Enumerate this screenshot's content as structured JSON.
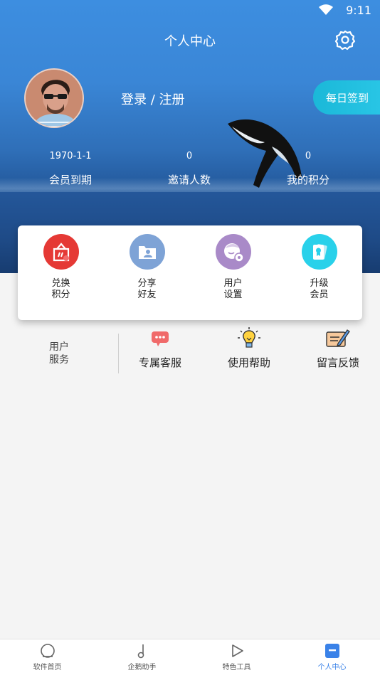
{
  "status_bar": {
    "time": "9:11"
  },
  "header": {
    "title": "个人中心"
  },
  "profile": {
    "login_text": "登录 / 注册",
    "signin_label": "每日签到"
  },
  "stats": [
    {
      "value": "1970-1-1",
      "label": "会员到期"
    },
    {
      "value": "0",
      "label": "邀请人数"
    },
    {
      "value": "0",
      "label": "我的积分"
    }
  ],
  "card_actions": [
    {
      "line1": "兑换",
      "line2": "积分",
      "icon": "gift-icon",
      "color": "#e53935"
    },
    {
      "line1": "分享",
      "line2": "好友",
      "icon": "share-contact-icon",
      "color": "#7ea3d6"
    },
    {
      "line1": "用户",
      "line2": "设置",
      "icon": "user-settings-icon",
      "color": "#a98ac8"
    },
    {
      "line1": "升级",
      "line2": "会员",
      "icon": "vip-card-icon",
      "color": "#29d1ea"
    }
  ],
  "services": {
    "label_line1": "用户",
    "label_line2": "服务",
    "items": [
      {
        "label": "专属客服",
        "icon": "chat-bubble-icon"
      },
      {
        "label": "使用帮助",
        "icon": "lightbulb-icon"
      },
      {
        "label": "留言反馈",
        "icon": "feedback-note-icon"
      }
    ]
  },
  "tabs": [
    {
      "label": "软件首页",
      "icon": "home-circle-icon"
    },
    {
      "label": "企鹅助手",
      "icon": "music-note-icon"
    },
    {
      "label": "特色工具",
      "icon": "play-triangle-icon"
    },
    {
      "label": "个人中心",
      "icon": "profile-box-icon",
      "active": true
    }
  ]
}
